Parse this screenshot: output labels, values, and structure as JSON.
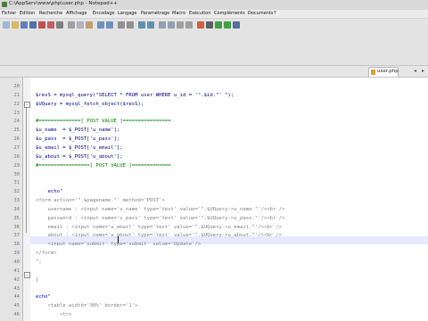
{
  "window": {
    "title": "C:\\AppServ\\www\\php\\user.php - Notepad++"
  },
  "menu": [
    "Fichier",
    "Edition",
    "Recherche",
    "Affichage",
    "Encodage",
    "Langage",
    "Paramétrage",
    "Macro",
    "Exécution",
    "Compléments",
    "Documents",
    "?"
  ],
  "tab": {
    "label": "user.php"
  },
  "editor": {
    "lines": [
      {
        "n": "20",
        "text": ""
      },
      {
        "n": "21",
        "text": "$resS = mysql_query(\"SELECT * FROM user WHERE u_id = '\".$id.\"' \");"
      },
      {
        "n": "22",
        "text": "$UQuery = mysql_fetch_object($resS);"
      },
      {
        "n": "23",
        "text": ""
      },
      {
        "n": "24",
        "text": "#==============[ POST VALUE ]================"
      },
      {
        "n": "25",
        "text": "$u_name  = $_POST['u_name'];"
      },
      {
        "n": "26",
        "text": "$u_pass  = $_POST['u_pass'];"
      },
      {
        "n": "27",
        "text": "$u_email = $_POST['u_email'];"
      },
      {
        "n": "28",
        "text": "$u_about = $_POST['u_about'];"
      },
      {
        "n": "29",
        "text": "#=================[ POST VALUE ]============="
      },
      {
        "n": "30",
        "text": ""
      },
      {
        "n": "31",
        "text": ""
      },
      {
        "n": "32",
        "text": "    echo\""
      },
      {
        "n": "33",
        "text": "<form action='\".$pagename.\"' method='POST'>"
      },
      {
        "n": "34",
        "text": "    username : <input name='u_name' type='text' value='\".$UQuery->u_name.\"'/><br />"
      },
      {
        "n": "35",
        "text": "    password : <input name='u_pass' type='text' value='\".$UQuery->u_pass.\"'/><br />"
      },
      {
        "n": "36",
        "text": "    email : <input name='u_email' type='text' value='\".$UQuery->u_email.\"'/><br />"
      },
      {
        "n": "37",
        "text": "    about : <input name='u_about' type='text' value='\".$UQuery->u_about.\"'/><br />"
      },
      {
        "n": "38",
        "text": "    <input name='submit' type='submit' value='Update'/>"
      },
      {
        "n": "39",
        "text": "</form>"
      },
      {
        "n": "40",
        "text": "\";"
      },
      {
        "n": "41",
        "text": ""
      },
      {
        "n": "42",
        "text": "}"
      },
      {
        "n": "43",
        "text": ""
      },
      {
        "n": "44",
        "text": "echo\""
      },
      {
        "n": "45",
        "text": "    <table width='30%' border='1'>"
      },
      {
        "n": "46",
        "text": "        <tr>"
      }
    ]
  },
  "colors": {
    "keyword": "#0000c0",
    "string": "#808080",
    "comment": "#008000",
    "variable": "#000080",
    "current_line": "#e8e8ff"
  }
}
